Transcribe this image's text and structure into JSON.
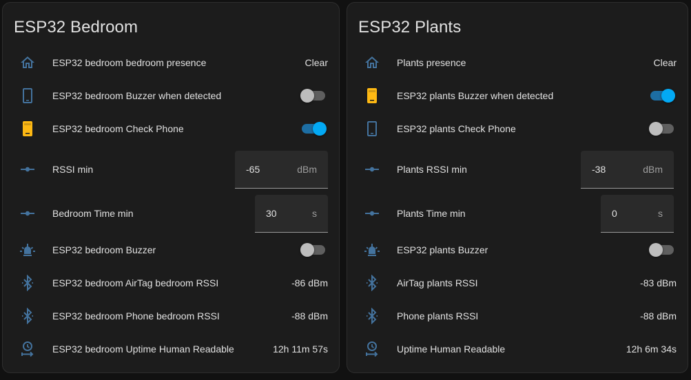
{
  "colors": {
    "icon_blue": "#44739e",
    "icon_active": "#fdb813",
    "toggle_on": "#03a9f4",
    "card_bg": "#1c1c1c",
    "text": "#e1e1e1"
  },
  "cards": [
    {
      "title": "ESP32 Bedroom",
      "rows": [
        {
          "icon": "home-outline-icon",
          "label": "ESP32 bedroom bedroom presence",
          "value": "Clear"
        },
        {
          "icon": "cellphone-icon",
          "label": "ESP32 bedroom Buzzer when detected",
          "toggle": "off"
        },
        {
          "icon": "cellphone-active-icon",
          "label": "ESP32 bedroom Check Phone",
          "toggle": "on"
        },
        {
          "icon": "ray-vertex-icon",
          "label": "RSSI min",
          "number": "-65",
          "unit": "dBm"
        },
        {
          "icon": "ray-vertex-icon",
          "label": "Bedroom Time min",
          "number": "30",
          "unit": "s"
        },
        {
          "icon": "alarm-light-icon",
          "label": "ESP32 bedroom Buzzer",
          "toggle": "off"
        },
        {
          "icon": "bluetooth-icon",
          "label": "ESP32 bedroom AirTag bedroom RSSI",
          "value": "-86 dBm"
        },
        {
          "icon": "bluetooth-icon",
          "label": "ESP32 bedroom Phone bedroom RSSI",
          "value": "-88 dBm"
        },
        {
          "icon": "clock-arrow-icon",
          "label": "ESP32 bedroom Uptime Human Readable",
          "value": "12h 11m 57s"
        }
      ]
    },
    {
      "title": "ESP32 Plants",
      "rows": [
        {
          "icon": "home-outline-icon",
          "label": "Plants presence",
          "value": "Clear"
        },
        {
          "icon": "cellphone-active-icon",
          "label": "ESP32 plants Buzzer when detected",
          "toggle": "on"
        },
        {
          "icon": "cellphone-icon",
          "label": "ESP32 plants Check Phone",
          "toggle": "off"
        },
        {
          "icon": "ray-vertex-icon",
          "label": "Plants RSSI min",
          "number": "-38",
          "unit": "dBm"
        },
        {
          "icon": "ray-vertex-icon",
          "label": "Plants Time min",
          "number": "0",
          "unit": "s"
        },
        {
          "icon": "alarm-light-icon",
          "label": "ESP32 plants Buzzer",
          "toggle": "off"
        },
        {
          "icon": "bluetooth-icon",
          "label": "AirTag plants RSSI",
          "value": "-83 dBm"
        },
        {
          "icon": "bluetooth-icon",
          "label": "Phone plants RSSI",
          "value": "-88 dBm"
        },
        {
          "icon": "clock-arrow-icon",
          "label": "Uptime Human Readable",
          "value": "12h 6m 34s"
        }
      ]
    }
  ]
}
